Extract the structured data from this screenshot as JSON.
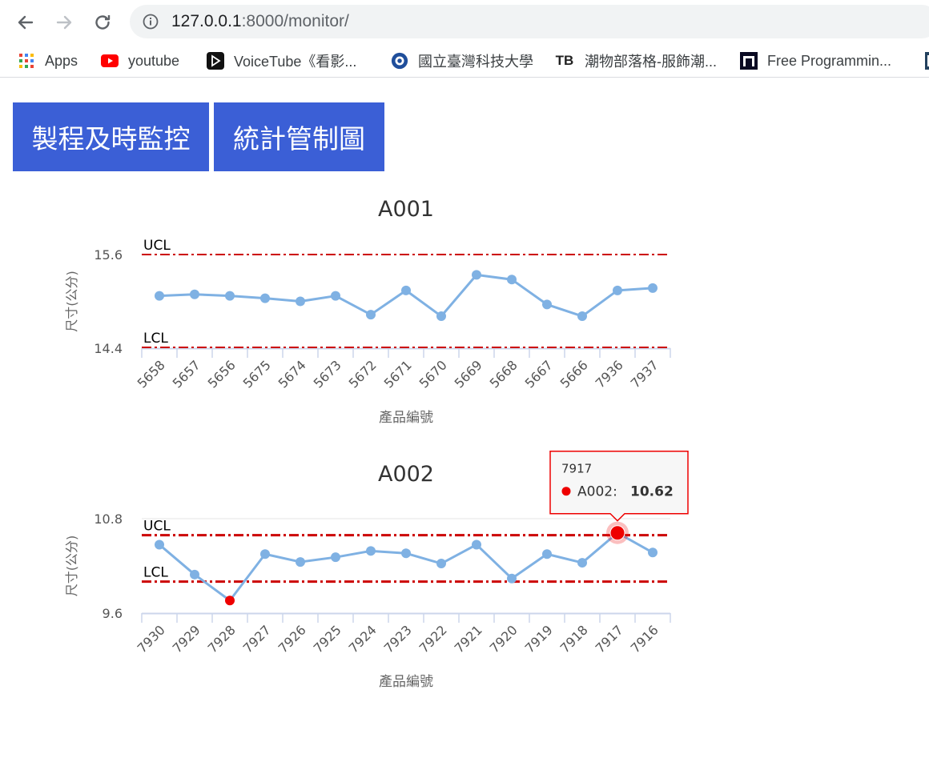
{
  "browser": {
    "url_host": "127.0.0.1",
    "url_rest": ":8000/monitor/",
    "bookmarks": [
      {
        "label": "Apps",
        "icon": "apps-grid-icon"
      },
      {
        "label": "youtube",
        "icon": "youtube-icon"
      },
      {
        "label": "VoiceTube《看影...",
        "icon": "voicetube-icon"
      },
      {
        "label": "國立臺灣科技大學",
        "icon": "ntust-icon"
      },
      {
        "label": "潮物部落格-服飾潮...",
        "icon": "tb-icon",
        "icon_text": "TB"
      },
      {
        "label": "Free Programmin...",
        "icon": "freecodecamp-icon"
      }
    ]
  },
  "tabs": [
    {
      "label": "製程及時監控"
    },
    {
      "label": "統計管制圖"
    }
  ],
  "colors": {
    "accent": "#3b5fd6",
    "line": "#7fb1e3",
    "limit": "#cc0000",
    "alarm": "#ee0000"
  },
  "chart_data": [
    {
      "type": "line",
      "title": "A001",
      "xlabel": "產品編號",
      "ylabel": "尺寸(公分)",
      "ylim": [
        14.4,
        15.6
      ],
      "y_ticks": [
        "15.6",
        "14.4"
      ],
      "categories": [
        "5658",
        "5657",
        "5656",
        "5675",
        "5674",
        "5673",
        "5672",
        "5671",
        "5670",
        "5669",
        "5668",
        "5667",
        "5666",
        "7936",
        "7937"
      ],
      "series": [
        {
          "values": [
            15.07,
            15.09,
            15.07,
            15.04,
            15.0,
            15.07,
            14.83,
            15.14,
            14.81,
            15.34,
            15.28,
            14.96,
            14.81,
            15.14,
            15.17
          ]
        }
      ],
      "ucl": {
        "label": "UCL",
        "value": 15.6
      },
      "lcl": {
        "label": "LCL",
        "value": 14.41
      },
      "grid": false
    },
    {
      "type": "line",
      "title": "A002",
      "xlabel": "產品編號",
      "ylabel": "尺寸(公分)",
      "ylim": [
        9.6,
        10.8
      ],
      "y_ticks": [
        "10.8",
        "9.6"
      ],
      "categories": [
        "7930",
        "7929",
        "7928",
        "7927",
        "7926",
        "7925",
        "7924",
        "7923",
        "7922",
        "7921",
        "7920",
        "7919",
        "7918",
        "7917",
        "7916"
      ],
      "series": [
        {
          "name": "A002",
          "values": [
            10.47,
            10.09,
            9.76,
            10.35,
            10.25,
            10.31,
            10.39,
            10.36,
            10.23,
            10.47,
            10.04,
            10.35,
            10.24,
            10.62,
            10.37
          ]
        }
      ],
      "ucl": {
        "label": "UCL",
        "value": 10.59
      },
      "lcl": {
        "label": "LCL",
        "value": 10.0
      },
      "out_of_control": [
        2,
        13
      ],
      "grid": true,
      "tooltip": {
        "category": "7917",
        "series": "A002",
        "value": "10.62",
        "index": 13
      }
    }
  ]
}
